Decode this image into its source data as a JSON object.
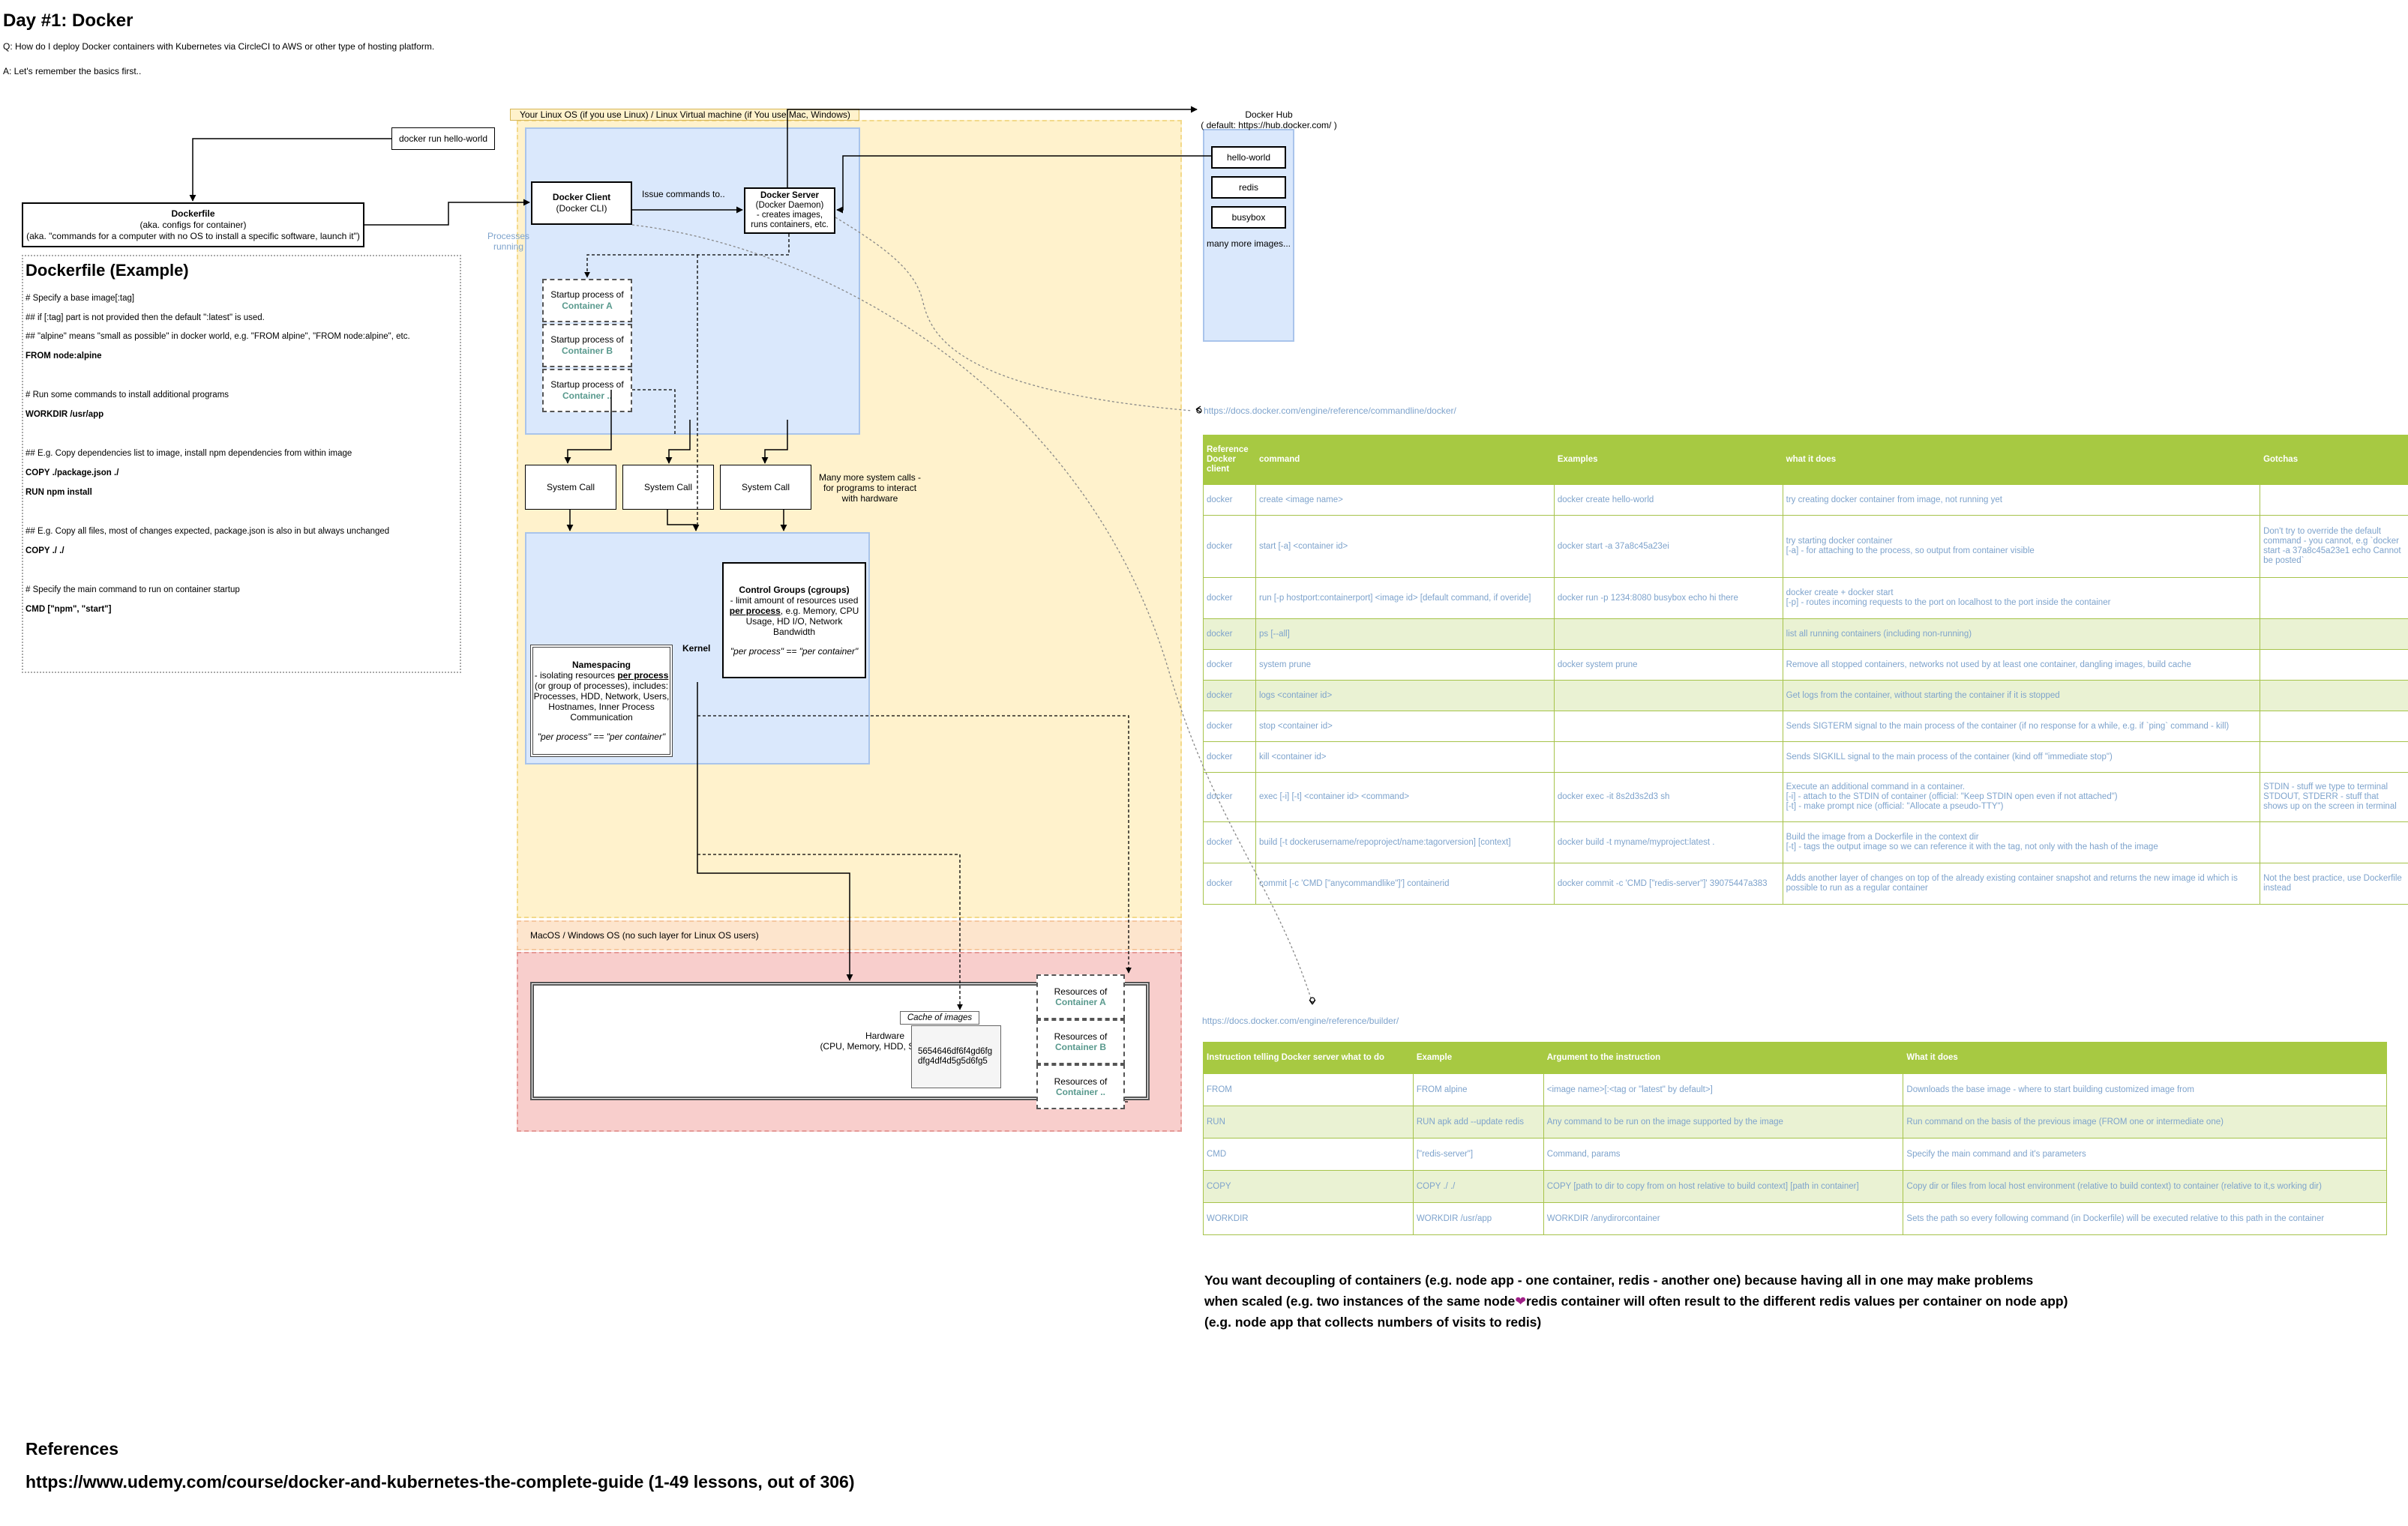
{
  "header": {
    "title": "Day #1: Docker",
    "question": "Q: How do I deploy Docker containers with Kubernetes via CircleCI to AWS or other type of hosting platform.",
    "answer": "A: Let's remember the basics first.."
  },
  "diagram": {
    "os_label": "Your Linux OS (if you use Linux) / Linux Virtual machine (if You use Mac, Windows)",
    "docker_run": "docker run hello-world",
    "dockerfile_box": {
      "title": "Dockerfile",
      "line1": "(aka. configs for container)",
      "line2": "(aka. \"commands for a computer with no OS to install a specific software, launch it\")"
    },
    "docker_client": {
      "title": "Docker Client",
      "sub": "(Docker CLI)"
    },
    "issue_commands": "Issue commands to..",
    "docker_server": {
      "title": "Docker Server",
      "l1": "(Docker Daemon)",
      "l2": "- creates images,",
      "l3": "runs containers, etc."
    },
    "processes_running": {
      "l1": "Processes",
      "l2": "running"
    },
    "startup": [
      {
        "label": "Startup process of",
        "name": "Container A"
      },
      {
        "label": "Startup process of",
        "name": "Container B"
      },
      {
        "label": "Startup process of",
        "name": "Container .."
      }
    ],
    "system_calls": [
      "System Call",
      "System Call",
      "System Call"
    ],
    "more_system_calls": {
      "l1": "Many more system calls -",
      "l2": "for programs to interact",
      "l3": "with hardware"
    },
    "kernel": "Kernel",
    "cgroups": {
      "title": "Control Groups (cgroups)",
      "l1": "- limit amount of resources used",
      "l2a": "per process",
      "l2b": ", e.g. Memory, CPU",
      "l3": "Usage, HD I/O, Network Bandwidth",
      "l4": "\"per process\" == \"per container\""
    },
    "namespacing": {
      "title": "Namespacing",
      "l1a": "- isolating resources ",
      "l1b": "per process",
      "l2": "(or group of processes), includes:",
      "l3": "Processes, HDD, Network, Users,",
      "l4": "Hostnames, Inner Process",
      "l5": "Communication",
      "l6": "\"per process\" == \"per container\""
    },
    "macos_label": "MacOS / Windows OS (no such layer for Linux OS users)",
    "hardware": {
      "title": "Hardware",
      "sub": "(CPU, Memory, HDD, SDD, etc.)"
    },
    "cache": {
      "title": "Cache of images",
      "l1": "5654646df6f4gd6fg",
      "l2": "dfg4df4d5g5d6fg5"
    },
    "resources": [
      {
        "label": "Resources of",
        "name": "Container A"
      },
      {
        "label": "Resources of",
        "name": "Container B"
      },
      {
        "label": "Resources of",
        "name": "Container .."
      }
    ],
    "hub": {
      "title": "Docker Hub",
      "sub": "( default: https://hub.docker.com/ )",
      "items": [
        "hello-world",
        "redis",
        "busybox"
      ],
      "more": "many more images..."
    }
  },
  "dockerfile_example": {
    "title": "Dockerfile (Example)",
    "lines": [
      "# Specify a base image[:tag]",
      "## if [:tag] part is not provided then the default \":latest\" is used.",
      "## \"alpine\" means \"small as possible\" in docker world, e.g. \"FROM alpine\", \"FROM node:alpine\", etc.",
      "FROM node:alpine",
      "# Run some commands to install additional programs",
      "WORKDIR /usr/app",
      "## E.g. Copy dependencies list to image, install npm dependencies from within image",
      "COPY ./package.json ./",
      "RUN npm install",
      "## E.g. Copy all files, most of changes expected, package.json is also in but always unchanged",
      "COPY ./ ./",
      "# Specify the main command to run on container startup",
      "CMD [\"npm\", \"start\"]"
    ]
  },
  "client_ref": {
    "link": "https://docs.docker.com/engine/reference/commandline/docker/",
    "headers": [
      "Reference Docker client",
      "command",
      "Examples",
      "what it does",
      "Gotchas"
    ],
    "rows": [
      [
        "docker",
        "create <image name>",
        "docker create hello-world",
        "try creating docker container from image, not running yet",
        ""
      ],
      [
        "docker",
        "start [-a] <container id>",
        "docker start -a 37a8c45a23ei",
        "try starting docker container\n[-a] - for attaching to the process, so output from container visible",
        "Don't try to override the default command - you cannot, e.g `docker start -a 37a8c45a23e1 echo Cannot be posted`"
      ],
      [
        "docker",
        "run [-p hostport:containerport] <image id> [default command, if overide]",
        "docker run -p 1234:8080 busybox echo hi there",
        "docker create + docker start\n[-p] - routes incoming requests to the port on localhost to the port inside the container",
        ""
      ],
      [
        "docker",
        "ps [--all]",
        "",
        "list all running containers (including non-running)",
        ""
      ],
      [
        "docker",
        "system prune",
        "docker system prune",
        "Remove all stopped containers, networks not used by at least one container, dangling images, build cache",
        ""
      ],
      [
        "docker",
        "logs <container id>",
        "",
        "Get logs from the container, without starting the container if it is stopped",
        ""
      ],
      [
        "docker",
        "stop <container id>",
        "",
        "Sends SIGTERM signal to the main process of the container (if no response for a while, e.g. if `ping` command - kill)",
        ""
      ],
      [
        "docker",
        "kill <container id>",
        "",
        "Sends SIGKILL signal to the main process of the container (kind off \"immediate stop\")",
        ""
      ],
      [
        "docker",
        "exec [-i] [-t] <container id> <command>",
        "docker exec -it 8s2d3s2d3 sh",
        "Execute an additional command in a container.\n[-i] - attach to the STDIN of container (official: \"Keep STDIN open even if not attached\")\n[-t] - make prompt nice (official: \"Allocate a pseudo-TTY\")",
        "STDIN - stuff we type to terminal\nSTDOUT, STDERR - stuff that shows up on the screen in terminal"
      ],
      [
        "docker",
        "build [-t dockerusername/repoproject/name:tagorversion] [context]",
        "docker build -t myname/myproject:latest .",
        "Build the image from a Dockerfile in the context dir\n[-t] - tags the output image so we can reference it with the tag, not only with the hash of the image",
        ""
      ],
      [
        "docker",
        "commit [-c 'CMD [\"anycommandlike\"]'] containerid",
        "docker commit -c 'CMD [\"redis-server\"]' 39075447a383",
        "Adds another layer of changes on top of the already existing container snapshot and returns the new image id which is possible to run as a regular container",
        "Not the best practice, use Dockerfile instead"
      ]
    ]
  },
  "builder_ref": {
    "link": "https://docs.docker.com/engine/reference/builder/",
    "headers": [
      "Instruction telling Docker server what to do",
      "Example",
      "Argument to the instruction",
      "What it does"
    ],
    "rows": [
      [
        "FROM",
        "FROM alpine",
        "<image name>[:<tag or \"latest\" by default>]",
        "Downloads the base image - where to start building customized image from"
      ],
      [
        "RUN",
        "RUN apk add --update redis",
        "Any command to be run on the image supported by the image",
        "Run command on the basis of the previous image (FROM one or intermediate one)"
      ],
      [
        "CMD",
        "[\"redis-server\"]",
        "Command, params",
        "Specify the main command and it's parameters"
      ],
      [
        "COPY",
        "COPY ./ ./",
        "COPY [path to dir to copy from on host relative to build context] [path in container]",
        "Copy dir or files from local host environment (relative to build context) to container (relative to it,s working dir)"
      ],
      [
        "WORKDIR",
        "WORKDIR /usr/app",
        "WORKDIR /anydirorcontainer",
        "Sets the path so every following command (in Dockerfile) will be executed relative to this path in the container"
      ]
    ]
  },
  "decoupling": {
    "l1": "You want decoupling of containers (e.g. node app - one container, redis - another one) because having all in one may make problems",
    "l2a": "when scaled (e.g. two instances of the same node",
    "l2b": "redis container will often result to the different redis values per container on node app)",
    "l3": "(e.g. node app that collects numbers of visits to redis)"
  },
  "references": {
    "title": "References",
    "url": "https://www.udemy.com/course/docker-and-kubernetes-the-complete-guide (1-49 lessons, out of 306)"
  },
  "colors": {
    "os_layer": "#fff2cc",
    "macos_layer": "#fde5cd",
    "hardware_layer": "#f8cecc",
    "blue_panel": "#dae8fc",
    "table_header": "#a7c942",
    "table_alt": "#eaf2d3",
    "link": "#7ea3cc",
    "teal": "#5a9a8e"
  }
}
